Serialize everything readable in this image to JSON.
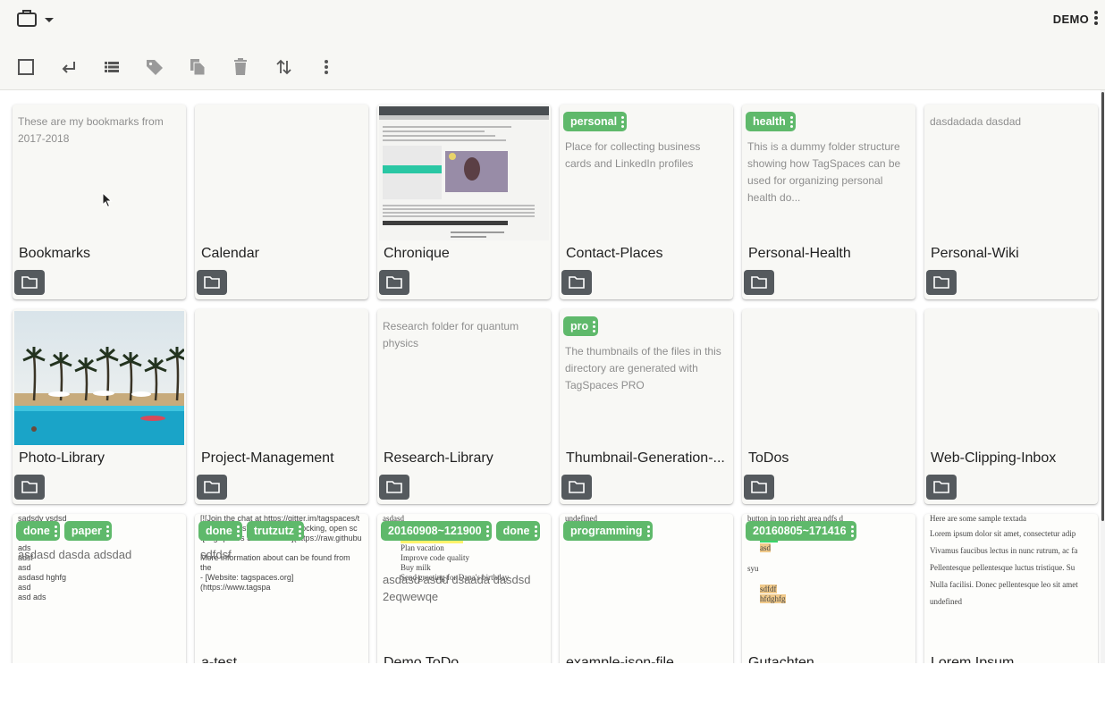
{
  "header": {
    "account_label": "DEMO",
    "icons": [
      "briefcase-icon",
      "chevron-down-icon",
      "more-vert-icon"
    ]
  },
  "toolbar": {
    "buttons": [
      {
        "name": "select-all-checkbox",
        "icon": "checkbox-outline-icon"
      },
      {
        "name": "parent-folder-button",
        "icon": "return-arrow-icon"
      },
      {
        "name": "view-mode-button",
        "icon": "list-icon"
      },
      {
        "name": "tag-button",
        "icon": "tag-icon"
      },
      {
        "name": "copy-button",
        "icon": "copy-icon"
      },
      {
        "name": "delete-button",
        "icon": "trash-icon"
      },
      {
        "name": "sort-button",
        "icon": "sort-arrows-icon"
      },
      {
        "name": "more-button",
        "icon": "more-vert-icon"
      }
    ]
  },
  "colors": {
    "tag_green": "#5fb96b",
    "folder_button": "#555a5e",
    "card_bg": "#f8f8f5",
    "header_bg": "#f7f7f4"
  },
  "folders": [
    {
      "title": "Bookmarks",
      "description": "These are my bookmarks from 2017-2018",
      "tags": []
    },
    {
      "title": "Calendar",
      "description": "",
      "tags": []
    },
    {
      "title": "Chronique",
      "description": "",
      "tags": [],
      "thumbnail": "webpage-screenshot"
    },
    {
      "title": "Contact-Places",
      "description": "Place for collecting business cards and LinkedIn profiles",
      "tags": [
        "personal"
      ]
    },
    {
      "title": "Personal-Health",
      "description": "This is a dummy folder structure showing how TagSpaces can be used for organizing personal health do...",
      "tags": [
        "health"
      ]
    },
    {
      "title": "Personal-Wiki",
      "description": "dasdadada dasdad",
      "tags": []
    },
    {
      "title": "Photo-Library",
      "description": "",
      "tags": [],
      "thumbnail": "pool-with-palm-trees"
    },
    {
      "title": "Project-Management",
      "description": "",
      "tags": []
    },
    {
      "title": "Research-Library",
      "description": "Research folder for quantum physics",
      "tags": []
    },
    {
      "title": "Thumbnail-Generation-...",
      "description": "The thumbnails of the files in this directory are generated with TagSpaces PRO",
      "tags": [
        "pro"
      ]
    },
    {
      "title": "ToDos",
      "description": "",
      "tags": []
    },
    {
      "title": "Web-Clipping-Inbox",
      "description": "",
      "tags": []
    }
  ],
  "files": [
    {
      "title": "",
      "tags": [
        "done",
        "paper"
      ],
      "description": "asdasd dasda adsdad",
      "preview_lines": [
        "sadsdv vsdsd",
        "asd",
        "asd",
        "ads",
        "adsf",
        "asd",
        "asdasd hghfg",
        "asd",
        "asd ads"
      ]
    },
    {
      "title": "a-test",
      "tags": [
        "done",
        "trutzutz"
      ],
      "description": "sdfdsf",
      "preview_lines": [
        "[![Join the chat at https://gitter.im/tagspaces/t",
        "**TagSpaces** is a free, no-locking, open sc",
        "![TagSpaces Start Screen](https://raw.githubu",
        "",
        "More information about can be found from the",
        "- [Website: tagspaces.org](https://www.tagspa"
      ]
    },
    {
      "title": "Demo ToDo",
      "tags": [
        "20160908~121900",
        "done"
      ],
      "description": "asdasd asdd dsaada dasdsd 2eqwewqe",
      "preview_lines": [
        "asdasd",
        "Example ToDo list:",
        "Call Alice at 9am",
        "Plan vacation",
        "Improve code quality",
        "Buy milk",
        "Send greeting for Dana's birthday"
      ]
    },
    {
      "title": "example-json-file",
      "tags": [
        "programming"
      ],
      "description": "",
      "preview_lines": [
        "undefined"
      ]
    },
    {
      "title": "Gutachten",
      "tags": [
        "20160805~171416"
      ],
      "description": "",
      "preview_lines": [
        "button in top right area ndfs d",
        "asdasd",
        "sdasd",
        "asd",
        "syu",
        "sdfdf",
        "hfdghfg"
      ]
    },
    {
      "title": "Lorem Ipsum",
      "tags": [],
      "description": "",
      "preview_lines": [
        "Here are some sample textada",
        "Lorem ipsum dolor sit amet, consectetur adip",
        "Vivamus faucibus lectus in nunc rutrum, ac fa",
        "Pellentesque pellentesque luctus tristique. Su",
        "Nulla facilisi. Donec pellentesque leo sit amet",
        "undefined"
      ]
    }
  ]
}
